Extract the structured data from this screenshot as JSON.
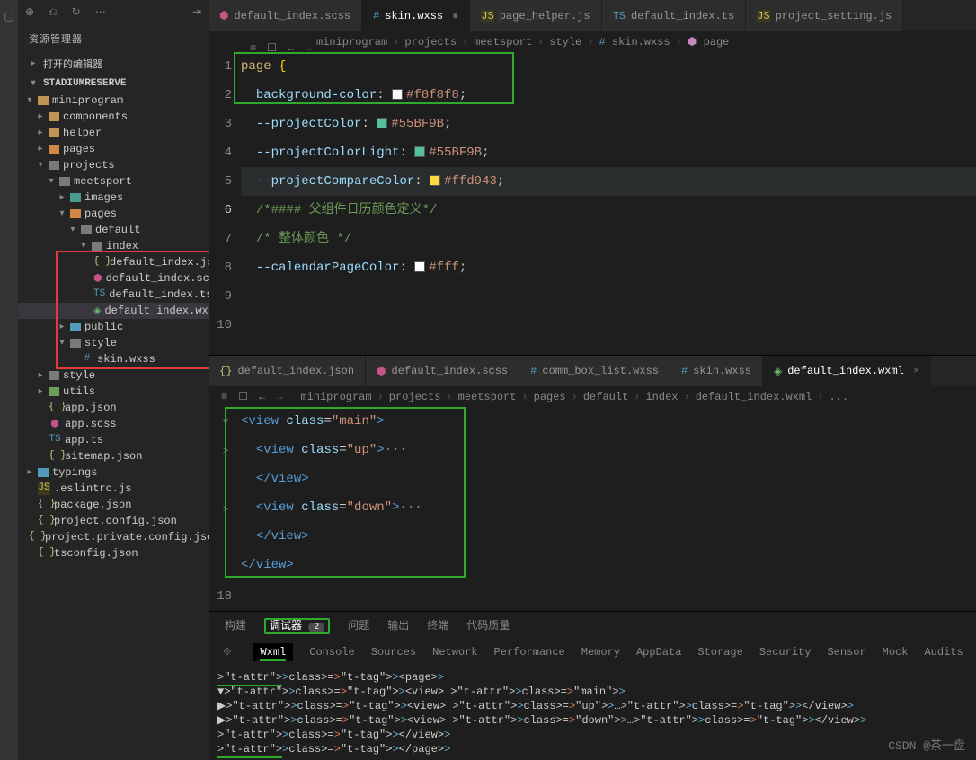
{
  "sidebar": {
    "title": "资源管理器",
    "sections": {
      "open_editors": "打开的编辑器",
      "workspace": "STADIUMRESERVE"
    },
    "tree": [
      {
        "name": "miniprogram",
        "type": "folder",
        "color": "folder-yellow",
        "depth": 0,
        "open": true
      },
      {
        "name": "components",
        "type": "folder",
        "color": "folder-yellow",
        "depth": 1,
        "open": false
      },
      {
        "name": "helper",
        "type": "folder",
        "color": "folder-yellow",
        "depth": 1,
        "open": false
      },
      {
        "name": "pages",
        "type": "folder",
        "color": "folder-orange",
        "depth": 1,
        "open": false
      },
      {
        "name": "projects",
        "type": "folder",
        "color": "folder-gray",
        "depth": 1,
        "open": true
      },
      {
        "name": "meetsport",
        "type": "folder",
        "color": "folder-gray",
        "depth": 2,
        "open": true
      },
      {
        "name": "images",
        "type": "folder",
        "color": "folder-teal",
        "depth": 3,
        "open": false
      },
      {
        "name": "pages",
        "type": "folder",
        "color": "folder-orange",
        "depth": 3,
        "open": true
      },
      {
        "name": "default",
        "type": "folder",
        "color": "folder-gray",
        "depth": 4,
        "open": true
      },
      {
        "name": "index",
        "type": "folder",
        "color": "folder-gray",
        "depth": 5,
        "open": true
      },
      {
        "name": "default_index.json",
        "type": "file",
        "icon": "i-json",
        "depth": 6
      },
      {
        "name": "default_index.scss",
        "type": "file",
        "icon": "i-scss",
        "depth": 6
      },
      {
        "name": "default_index.ts",
        "type": "file",
        "icon": "i-ts",
        "depth": 6
      },
      {
        "name": "default_index.wxml",
        "type": "file",
        "icon": "i-wxml",
        "depth": 6,
        "sel": true
      },
      {
        "name": "public",
        "type": "folder",
        "color": "folder-blue",
        "depth": 3,
        "open": false
      },
      {
        "name": "style",
        "type": "folder",
        "color": "folder-gray",
        "depth": 3,
        "open": true
      },
      {
        "name": "skin.wxss",
        "type": "file",
        "icon": "i-wxss",
        "depth": 4
      },
      {
        "name": "style",
        "type": "folder",
        "color": "folder-gray",
        "depth": 1,
        "open": false
      },
      {
        "name": "utils",
        "type": "folder",
        "color": "folder-green",
        "depth": 1,
        "open": false
      },
      {
        "name": "app.json",
        "type": "file",
        "icon": "i-json",
        "depth": 1
      },
      {
        "name": "app.scss",
        "type": "file",
        "icon": "i-scss",
        "depth": 1
      },
      {
        "name": "app.ts",
        "type": "file",
        "icon": "i-ts",
        "depth": 1
      },
      {
        "name": "sitemap.json",
        "type": "file",
        "icon": "i-json",
        "depth": 1
      },
      {
        "name": "typings",
        "type": "folder",
        "color": "folder-blue",
        "depth": 0,
        "open": false
      },
      {
        "name": ".eslintrc.js",
        "type": "file",
        "icon": "i-js",
        "depth": 0
      },
      {
        "name": "package.json",
        "type": "file",
        "icon": "i-json",
        "depth": 0
      },
      {
        "name": "project.config.json",
        "type": "file",
        "icon": "i-json",
        "depth": 0
      },
      {
        "name": "project.private.config.json",
        "type": "file",
        "icon": "i-json",
        "depth": 0
      },
      {
        "name": "tsconfig.json",
        "type": "file",
        "icon": "i-json",
        "depth": 0
      }
    ]
  },
  "tabs_top": [
    {
      "label": "default_index.scss",
      "icon": "i-scss",
      "active": false
    },
    {
      "label": "skin.wxss",
      "icon": "i-wxss",
      "active": true
    },
    {
      "label": "page_helper.js",
      "icon": "i-js",
      "active": false
    },
    {
      "label": "default_index.ts",
      "icon": "i-ts",
      "active": false
    },
    {
      "label": "project_setting.js",
      "icon": "i-js",
      "active": false
    }
  ],
  "crumbs1": [
    "miniprogram",
    "projects",
    "meetsport",
    "style",
    "skin.wxss",
    "page"
  ],
  "editor1": {
    "lines": [
      {
        "n": 1,
        "html": "<span class='tok-sel'>page</span> <span class='tok-brace'>{</span>"
      },
      {
        "n": 2,
        "html": "  <span class='tok-prop'>background-color</span>: <span class='swatch' style='background:#f8f8f8'></span><span class='tok-hex'>#f8f8f8</span>;"
      },
      {
        "n": 3,
        "html": ""
      },
      {
        "n": 4,
        "html": "  <span class='tok-prop'>--projectColor</span>: <span class='swatch' style='background:#55BF9B'></span><span class='tok-hex'>#55BF9B</span>;"
      },
      {
        "n": 5,
        "html": "  <span class='tok-prop'>--projectColorLight</span>: <span class='swatch' style='background:#55BF9B'></span><span class='tok-hex'>#55BF9B</span>;"
      },
      {
        "n": 6,
        "cur": true,
        "html": "  <span class='tok-prop'>--projectCompareColor</span>: <span class='swatch' style='background:#ffd943'></span><span class='tok-hex'>#ffd943</span>;"
      },
      {
        "n": 7,
        "html": ""
      },
      {
        "n": 8,
        "html": "  <span class='tok-comment'>/*#### 父组件日历颜色定义*/</span>"
      },
      {
        "n": 9,
        "html": "  <span class='tok-comment'>/* 整体颜色 */</span>"
      },
      {
        "n": 10,
        "html": "  <span class='tok-prop'>--calendarPageColor</span>: <span class='swatch' style='background:#fff'></span><span class='tok-hex'>#fff</span>;"
      }
    ]
  },
  "tabs2": [
    {
      "label": "default_index.json",
      "icon": "i-json",
      "active": false
    },
    {
      "label": "default_index.scss",
      "icon": "i-scss",
      "active": false
    },
    {
      "label": "comm_box_list.wxss",
      "icon": "i-wxss",
      "active": false
    },
    {
      "label": "skin.wxss",
      "icon": "i-wxss",
      "active": false
    },
    {
      "label": "default_index.wxml",
      "icon": "i-wxml",
      "active": true,
      "close": true
    }
  ],
  "crumbs2": [
    "miniprogram",
    "projects",
    "meetsport",
    "pages",
    "default",
    "index",
    "default_index.wxml",
    "..."
  ],
  "editor2": {
    "lines": [
      {
        "html": "<span class='tag'>&lt;view</span> <span class='attr'>class</span>=<span class='str'>\"main\"</span><span class='tag'>&gt;</span>",
        "fold": "v"
      },
      {
        "html": "  <span class='tag'>&lt;view</span> <span class='attr'>class</span>=<span class='str'>\"up\"</span><span class='tag'>&gt;</span><span class='dots'>···</span>",
        "fold": ">"
      },
      {
        "html": "  <span class='tag'>&lt;/view&gt;</span>"
      },
      {
        "html": "  <span class='tag'>&lt;view</span> <span class='attr'>class</span>=<span class='str'>\"down\"</span><span class='tag'>&gt;</span><span class='dots'>···</span>",
        "fold": ">"
      },
      {
        "html": "  <span class='tag'>&lt;/view&gt;</span>"
      },
      {
        "html": "<span class='tag'>&lt;/view&gt;</span>"
      }
    ],
    "last_line_num": "18"
  },
  "panel": {
    "tabs": [
      "构建",
      "调试器",
      "问题",
      "输出",
      "终端",
      "代码质量"
    ],
    "active": 1,
    "badge": "2",
    "devtabs": [
      "Wxml",
      "Console",
      "Sources",
      "Network",
      "Performance",
      "Memory",
      "AppData",
      "Storage",
      "Security",
      "Sensor",
      "Mock",
      "Audits"
    ],
    "devactive": 0
  },
  "dom": [
    "<page>",
    "▼<view class=\"main\">",
    "  ▶<view class=\"up\">…</view>",
    "  ▶<view class=\"down\">…</view>",
    " </view>",
    "</page>"
  ],
  "watermark": "CSDN @茶一盘"
}
